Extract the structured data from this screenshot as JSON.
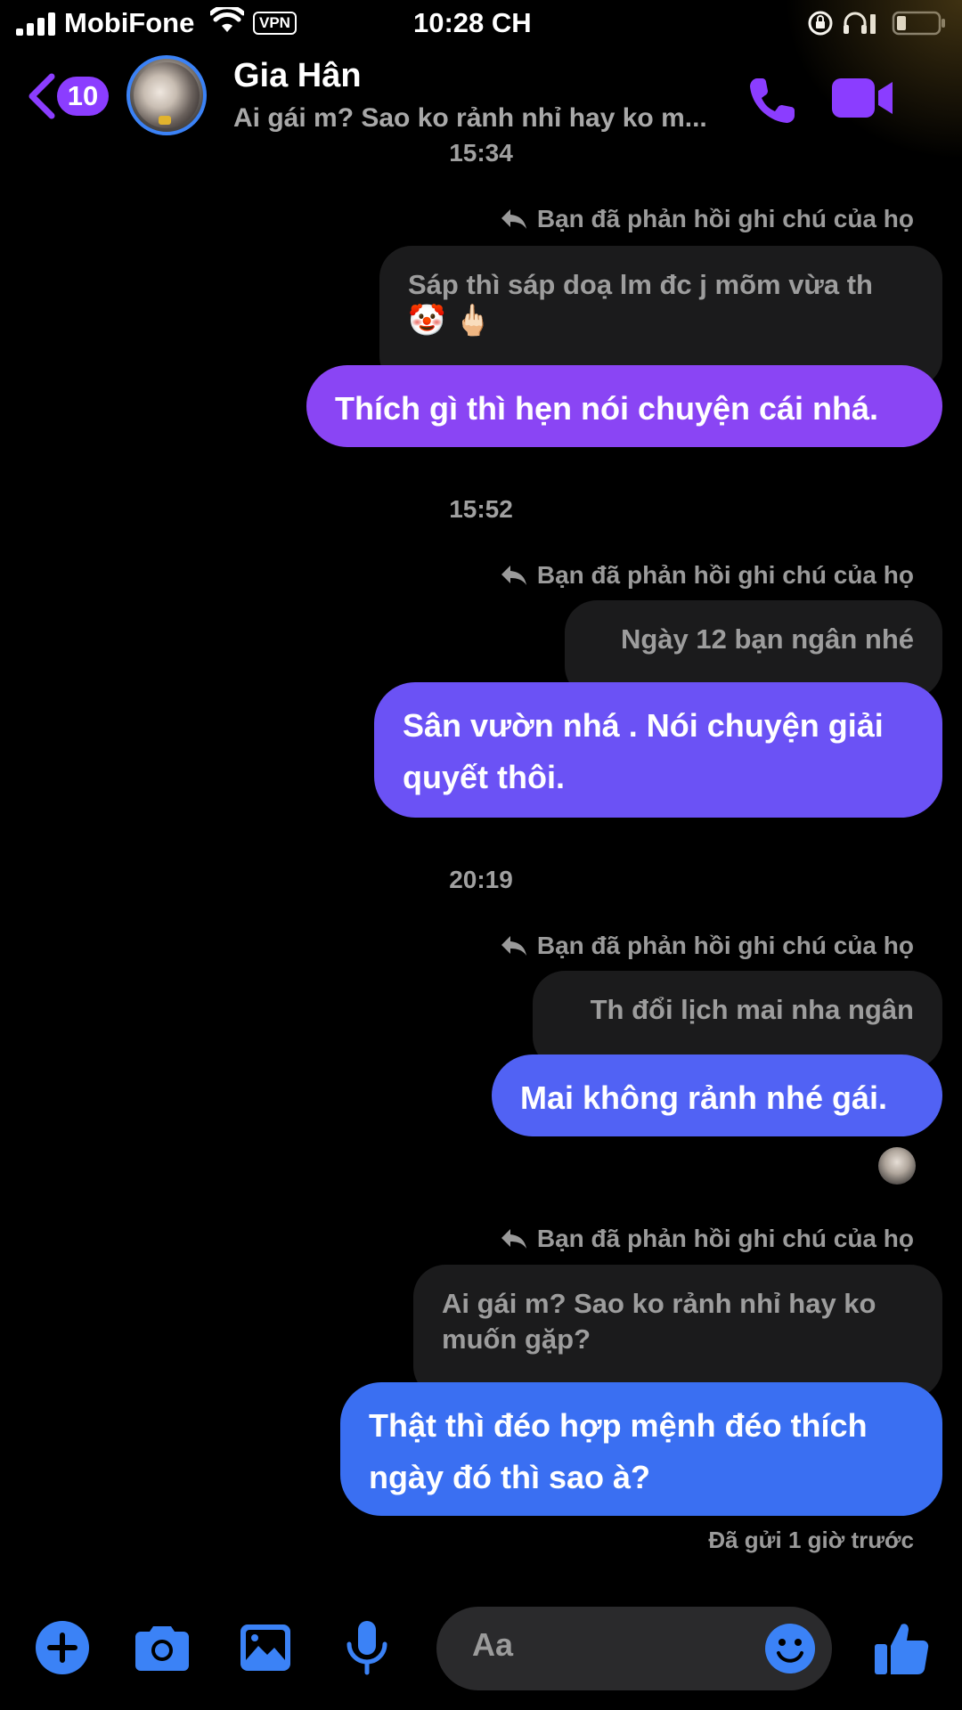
{
  "status_bar": {
    "carrier": "MobiFone",
    "vpn": "VPN",
    "time": "10:28 CH"
  },
  "header": {
    "unread_count": "10",
    "contact_name": "Gia Hân",
    "preview": "Ai gái m? Sao ko rảnh nhỉ hay ko m..."
  },
  "messages": {
    "ts0": "15:34",
    "note1": "Bạn đã phản hồi ghi chú của họ",
    "quote1": "Sáp thì sáp doạ lm đc j mõm vừa th",
    "quote1_emoji": "🤡 🖕🏻",
    "sent1": "Thích gì thì hẹn nói chuyện cái nhá.",
    "ts1": "15:52",
    "note2": "Bạn đã phản hồi ghi chú của họ",
    "quote2": "Ngày 12 bạn ngân nhé",
    "sent2": "Sân vườn nhá . Nói chuyện giải quyết thôi.",
    "ts2": "20:19",
    "note3": "Bạn đã phản hồi ghi chú của họ",
    "quote3": "Th đổi lịch mai nha ngân",
    "sent3": "Mai không rảnh nhé gái.",
    "note4": "Bạn đã phản hồi ghi chú của họ",
    "quote4": "Ai gái m? Sao ko rảnh nhỉ hay ko muốn gặp?",
    "sent4": "Thật thì đéo hợp mệnh đéo thích ngày đó thì sao à?",
    "delivered": "Đã gửi 1 giờ trước"
  },
  "composer": {
    "placeholder": "Aa"
  },
  "colors": {
    "accent_purple": "#8b3dff",
    "accent_blue": "#3b82f6",
    "bubble_grad_1": "#8a45f4",
    "bubble_grad_4": "#3a6ff2"
  },
  "icons": [
    "signal-icon",
    "wifi-icon",
    "lock-rotation-icon",
    "headphones-icon",
    "battery-icon",
    "back-icon",
    "phone-icon",
    "video-icon",
    "reply-icon",
    "plus-icon",
    "camera-icon",
    "image-icon",
    "mic-icon",
    "emoji-icon",
    "like-icon"
  ]
}
